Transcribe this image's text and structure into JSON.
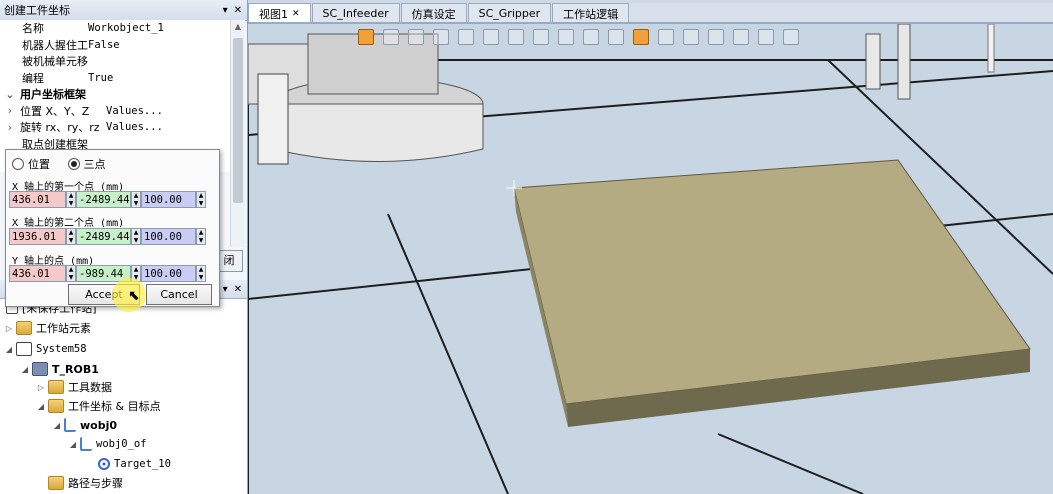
{
  "panel_title": "创建工件坐标",
  "panel_controls": {
    "pin": "▾",
    "close": "✕"
  },
  "props": [
    {
      "k": "名称",
      "v": "Workobject_1"
    },
    {
      "k": "机器人握住工件",
      "v": "False"
    },
    {
      "k": "被机械单元移动",
      "v": ""
    },
    {
      "k": "编程",
      "v": "True"
    },
    {
      "k": "用户坐标框架",
      "v": "",
      "group": true
    },
    {
      "k": "位置 X、Y、Z",
      "v": "Values...",
      "exp": "›"
    },
    {
      "k": "旋转 rx、ry、rz",
      "v": "Values...",
      "exp": "›"
    },
    {
      "k": "取点创建框架",
      "v": ""
    }
  ],
  "close_label": "闭",
  "popup": {
    "radio_position": "位置",
    "radio_three_points": "三点",
    "label_x1": "X 轴上的第一个点 (mm)",
    "label_x2": "X 轴上的第二个点 (mm)",
    "label_y": "Y 轴上的点 (mm)",
    "p1": [
      "436.01",
      "-2489.44",
      "100.00"
    ],
    "p2": [
      "1936.01",
      "-2489.44",
      "100.00"
    ],
    "p3": [
      "436.01",
      "-989.44",
      "100.00"
    ],
    "accept": "Accept",
    "cancel": "Cancel"
  },
  "tree_title": "",
  "tree": {
    "station": "[未保存工作站]",
    "station_elements": "工作站元素",
    "system": "System58",
    "rob": "T_ROB1",
    "tooldata": "工具数据",
    "workobjects": "工件坐标 & 目标点",
    "wobj0": "wobj0",
    "wobj0_of": "wobj0_of",
    "target": "Target_10",
    "paths": "路径与步骤"
  },
  "tabs": [
    {
      "label": "视图1",
      "active": true,
      "closable": true
    },
    {
      "label": "SC_Infeeder"
    },
    {
      "label": "仿真设定"
    },
    {
      "label": "SC_Gripper"
    },
    {
      "label": "工作站逻辑"
    }
  ],
  "colors": {
    "table_top": "#b5ab82",
    "table_side": "#6f6a4d",
    "floor": "#c7d5e3",
    "grid": "#1b1b1b"
  }
}
